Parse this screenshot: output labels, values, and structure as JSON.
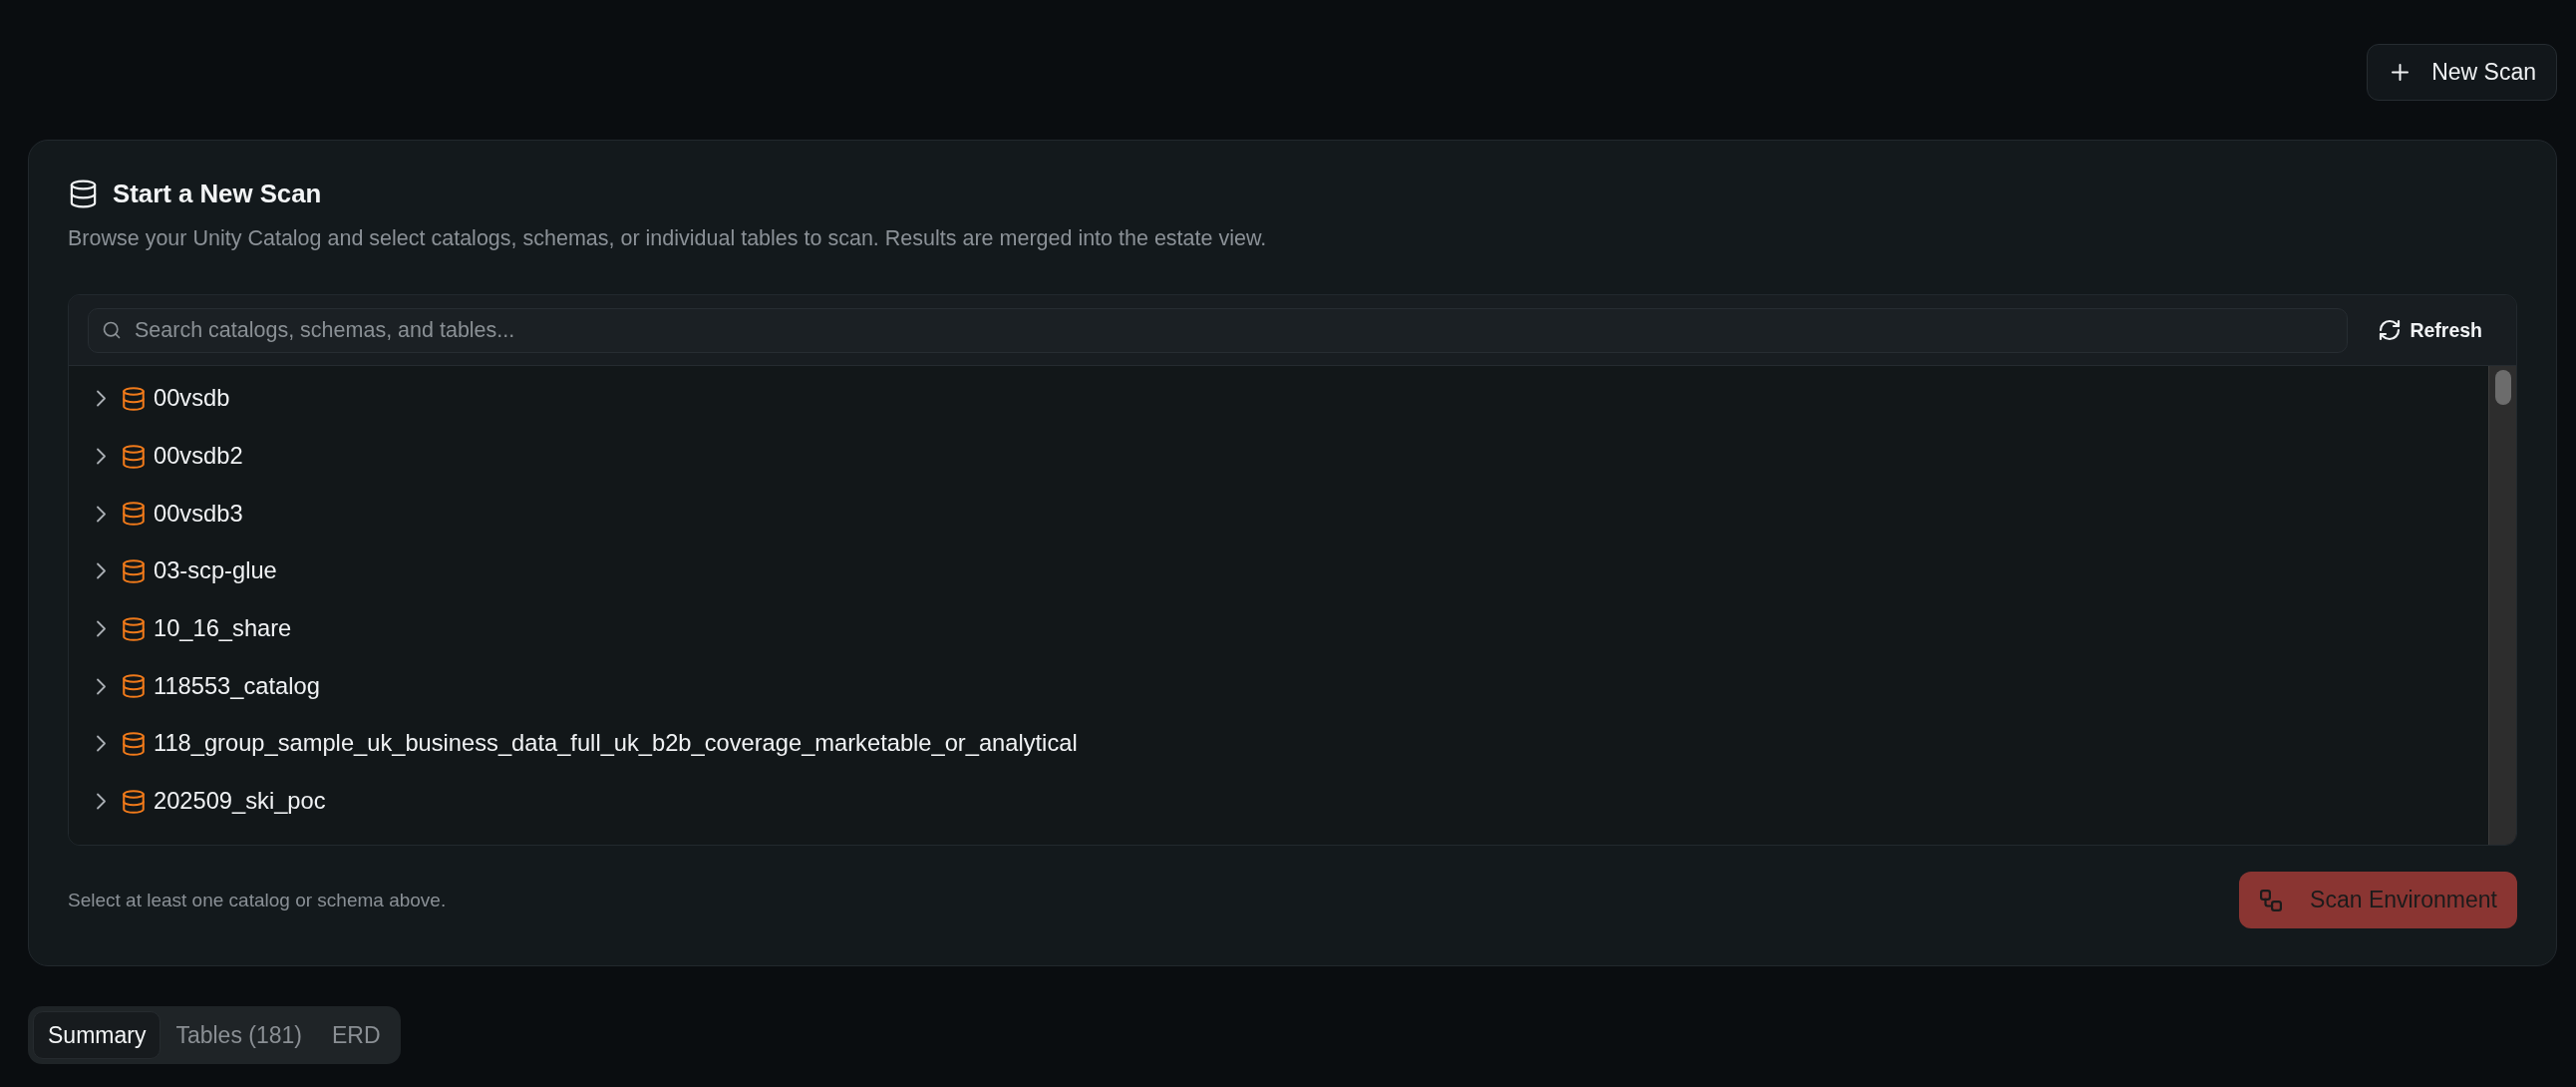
{
  "header": {
    "new_scan_button": "New Scan"
  },
  "scan": {
    "title": "Start a New Scan",
    "description": "Browse your Unity Catalog and select catalogs, schemas, or individual tables to scan. Results are merged into the estate view.",
    "browser": {
      "search": {
        "placeholder": "Search catalogs, schemas, and tables..."
      },
      "refresh_button": "Refresh",
      "catalogs": [
        {
          "name": "00vsdb",
          "expanded": false
        },
        {
          "name": "00vsdb2",
          "expanded": false
        },
        {
          "name": "00vsdb3",
          "expanded": false
        },
        {
          "name": "03-scp-glue",
          "expanded": false
        },
        {
          "name": "10_16_share",
          "expanded": false
        },
        {
          "name": "118553_catalog",
          "expanded": false
        },
        {
          "name": "118_group_sample_uk_business_data_full_uk_b2b_coverage_marketable_or_analytical",
          "expanded": false
        },
        {
          "name": "202509_ski_poc",
          "expanded": false
        }
      ]
    },
    "hint": "Select at least one catalog or schema above.",
    "scan_button": {
      "label": "Scan Environment",
      "disabled": true
    }
  },
  "tabs": [
    {
      "label": "Summary",
      "selected": true
    },
    {
      "label": "Tables (181)",
      "selected": false
    },
    {
      "label": "ERD",
      "selected": false
    }
  ]
}
